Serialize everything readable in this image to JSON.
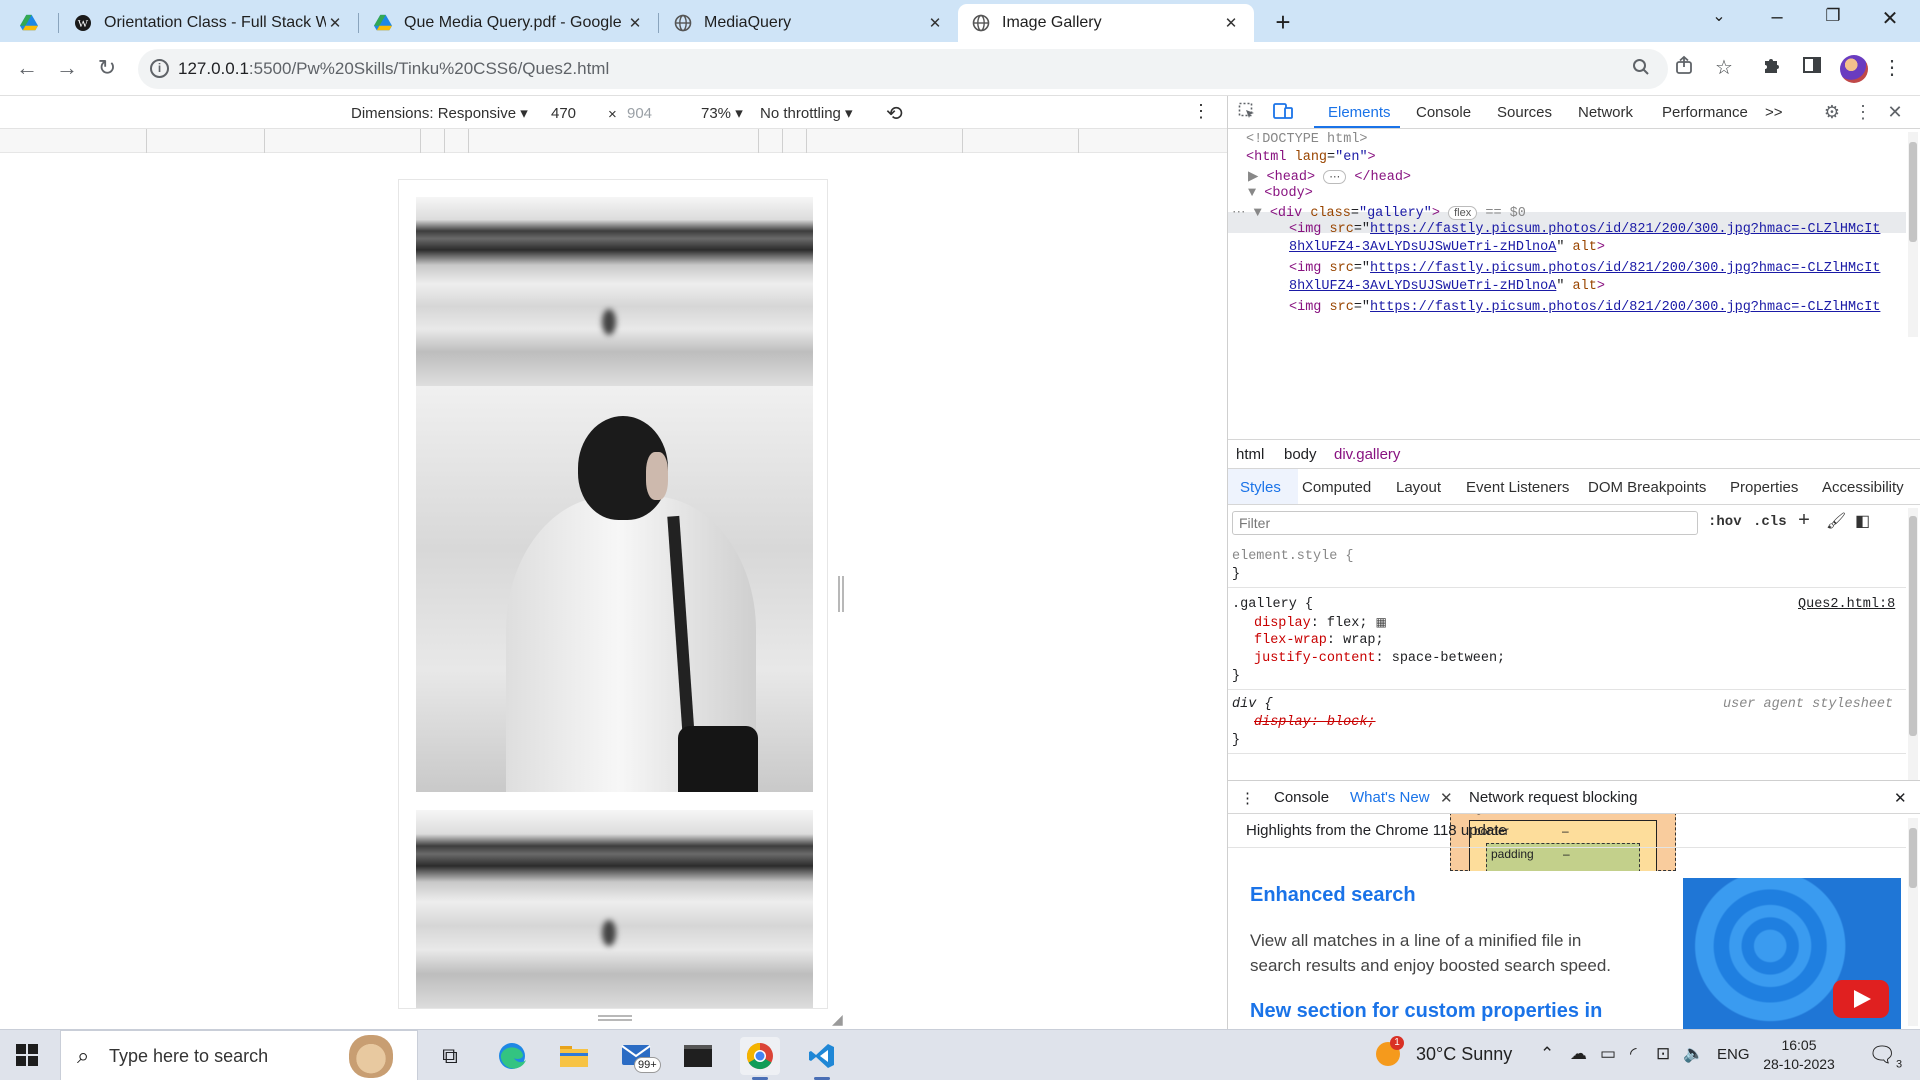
{
  "browser": {
    "tabs": [
      {
        "title": "Orientation Class - Full Stack We",
        "favicon": "wordpress-icon",
        "close": "✕"
      },
      {
        "title": "Que Media Query.pdf - Google D",
        "favicon": "google-drive-icon",
        "close": "✕"
      },
      {
        "title": "MediaQuery",
        "favicon": "globe-icon",
        "close": "✕"
      },
      {
        "title": "Image Gallery",
        "favicon": "globe-icon",
        "close": "✕",
        "active": true
      }
    ],
    "new_tab": "+",
    "address": {
      "host": "127.0.0.1",
      "rest": ":5500/Pw%20Skills/Tinku%20CSS6/Ques2.html"
    }
  },
  "device_toolbar": {
    "dimensions_label": "Dimensions: Responsive",
    "width": "470",
    "height": "904",
    "times": "×",
    "zoom": "73%",
    "throttling": "No throttling"
  },
  "devtools": {
    "tabs": [
      "Elements",
      "Console",
      "Sources",
      "Network",
      "Performance"
    ],
    "more_tabs": ">>",
    "dom": {
      "doctype": "<!DOCTYPE html>",
      "html_open": "<html",
      "lang_attr": "lang",
      "lang_val": "\"en\"",
      "head": "<head>",
      "head_close": "</head>",
      "ellipsis": "⋯",
      "body": "<body>",
      "div_open": "<div",
      "class_attr": "class",
      "class_val": "\"gallery\"",
      "flex_badge": "flex",
      "dollar0": "== $0",
      "img_tag": "<img",
      "src_attr": "src",
      "alt_attr": "alt",
      "src_line1": "https://fastly.picsum.photos/id/821/200/300.jpg?hmac=-CLZlHMcIt",
      "src_line2": "8hXlUFZ4-3AvLYDsUJSwUeTri-zHDlnoA"
    },
    "breadcrumbs": [
      "html",
      "body",
      "div.gallery"
    ],
    "style_tabs": [
      "Styles",
      "Computed",
      "Layout",
      "Event Listeners",
      "DOM Breakpoints",
      "Properties",
      "Accessibility"
    ],
    "filter_placeholder": "Filter",
    "hov": ":hov",
    "cls": ".cls",
    "styles": {
      "element_style": "element.style {",
      "close_brace": "}",
      "gallery_selector": ".gallery {",
      "gallery_source": "Ques2.html:8",
      "gallery_props": [
        {
          "name": "display",
          "value": "flex;"
        },
        {
          "name": "flex-wrap",
          "value": "wrap;"
        },
        {
          "name": "justify-content",
          "value": "space-between;"
        }
      ],
      "div_selector": "div {",
      "div_source": "user agent stylesheet",
      "div_prop": "display: block;"
    },
    "box_model": {
      "margin": "margin",
      "border": "border",
      "padding": "padding",
      "dash": "–"
    },
    "drawer_tabs": [
      "Console",
      "What's New",
      "Network request blocking"
    ],
    "highlights": "Highlights from the Chrome 118 update",
    "whats_new": {
      "heading1": "Enhanced search",
      "text1": "View all matches in a line of a minified file in search results and enjoy boosted search speed.",
      "heading2": "New section for custom properties in"
    }
  },
  "taskbar": {
    "search_placeholder": "Type here to search",
    "mail_badge": "99+",
    "weather": "30°C  Sunny",
    "weather_alert": "1",
    "language": "ENG",
    "time": "16:05",
    "date": "28-10-2023",
    "notifications": "3"
  }
}
